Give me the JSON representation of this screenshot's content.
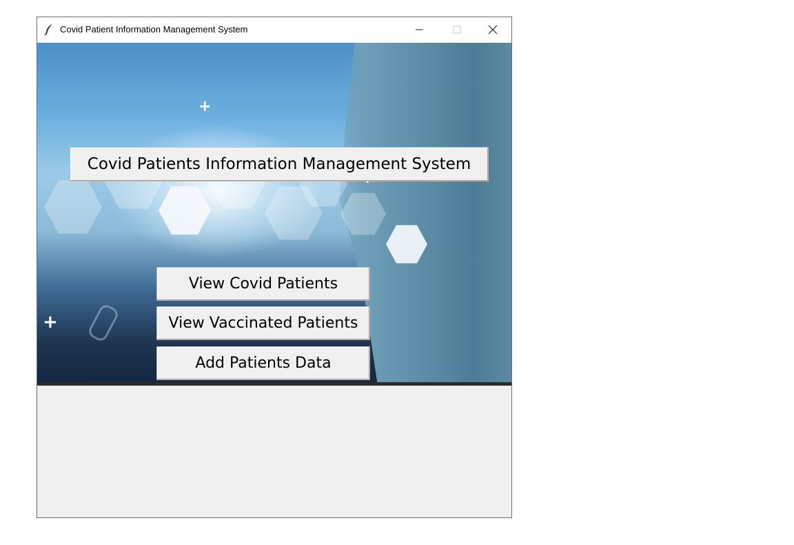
{
  "window": {
    "title": "Covid Patient Information Management System",
    "controls": [
      "minimize-icon",
      "maximize-icon",
      "close-icon"
    ]
  },
  "main": {
    "header_label": "Covid Patients Information Management System",
    "buttons": [
      {
        "label": "View Covid Patients"
      },
      {
        "label": "View Vaccinated Patients"
      },
      {
        "label": "Add Patients Data"
      }
    ]
  },
  "colors": {
    "button_face": "#f0f0f0",
    "window_bg": "#f0f0f0",
    "titlebar_bg": "#ffffff"
  }
}
